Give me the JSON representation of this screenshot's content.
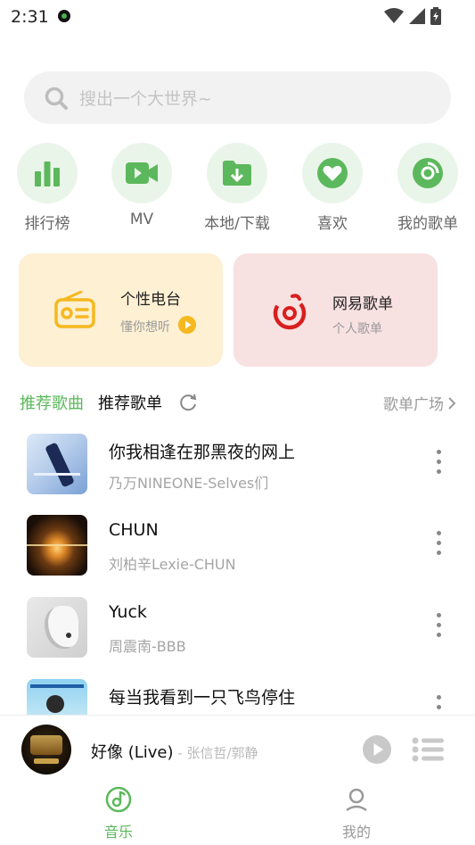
{
  "status_bar": {
    "time": "2:31"
  },
  "search": {
    "placeholder": "搜出一个大世界~"
  },
  "quick_actions": [
    {
      "label": "排行榜",
      "icon": "chart-icon"
    },
    {
      "label": "MV",
      "icon": "video-icon"
    },
    {
      "label": "本地/下载",
      "icon": "folder-download-icon"
    },
    {
      "label": "喜欢",
      "icon": "heart-icon"
    },
    {
      "label": "我的歌单",
      "icon": "disc-icon"
    }
  ],
  "cards": {
    "radio": {
      "title": "个性电台",
      "subtitle": "懂你想听",
      "color": "#fdf0d3"
    },
    "netease": {
      "title": "网易歌单",
      "subtitle": "个人歌单",
      "color": "#f8e1e1"
    }
  },
  "section": {
    "tab_songs": "推荐歌曲",
    "tab_playlists": "推荐歌单",
    "plaza": "歌单广场"
  },
  "songs": [
    {
      "title": "你我相逢在那黑夜的网上",
      "artist": "乃万NINEONE-Selves们"
    },
    {
      "title": "CHUN",
      "artist": "刘柏辛Lexie-CHUN"
    },
    {
      "title": "Yuck",
      "artist": "周震南-BBB"
    },
    {
      "title": "每当我看到一只飞鸟停住",
      "artist": ""
    }
  ],
  "player": {
    "title": "好像 (Live)",
    "artist": " - 张信哲/郭静"
  },
  "nav": {
    "music": "音乐",
    "mine": "我的"
  },
  "colors": {
    "accent": "#5cb85c",
    "accent_dark": "#3fa34d",
    "netease_red": "#d81e1e",
    "radio_yellow": "#f5b81f"
  }
}
